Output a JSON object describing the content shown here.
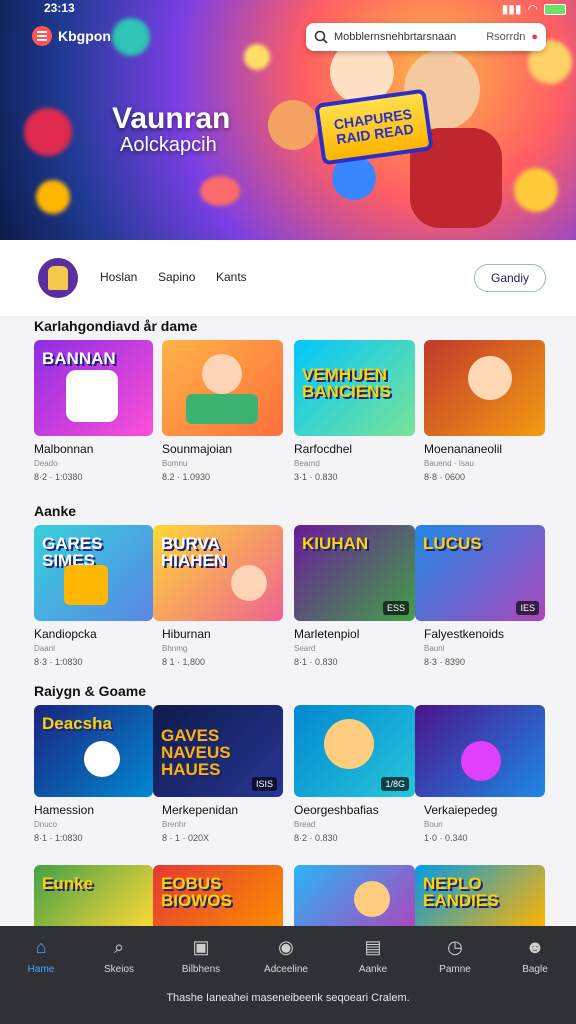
{
  "status": {
    "time": "23:13"
  },
  "header": {
    "app_name": "Kbgpon",
    "search_placeholder": "Mobblernsnehbrtarsnaan",
    "search_button": "Rsorrdn"
  },
  "hero": {
    "title": "Vaunran",
    "subtitle": "Aolckapcih",
    "badge": "CHAPURES RAID READ"
  },
  "profile_bar": {
    "tabs": [
      "Hoslan",
      "Sapino",
      "Kants"
    ],
    "action": "Gandiy"
  },
  "sections": [
    {
      "title": "Karlahgondiavd år dame",
      "cards": [
        {
          "name": "Malbonnan",
          "category": "Deado",
          "stats": "8·2 · 1:0380",
          "overlay": "BANNAN"
        },
        {
          "name": "Sounmajoian",
          "category": "Bomnu",
          "stats": "8.2 · 1.0930",
          "overlay": ""
        },
        {
          "name": "Rarfocdhel",
          "category": "Bearnd",
          "stats": "3·1 · 0.830",
          "overlay": "VEMHUEN BANCIENS"
        },
        {
          "name": "Moenananeolil",
          "category": "Bauend · Isau",
          "stats": "8·8 · 0600",
          "overlay": ""
        }
      ]
    },
    {
      "title": "Aanke",
      "cards": [
        {
          "name": "Kandiopcka",
          "category": "Daanl",
          "stats": "8·3 · 1:0830",
          "overlay": "GARES SIMES",
          "tag": ""
        },
        {
          "name": "Hiburnan",
          "category": "Bhnmg",
          "stats": "8 1 · 1,800",
          "overlay": "BURVA HIAHEN",
          "tag": ""
        },
        {
          "name": "Marletenpiol",
          "category": "Seard",
          "stats": "8·1 · 0.830",
          "overlay": "KIUHAN",
          "tag": "ESS"
        },
        {
          "name": "Falyestkenoids",
          "category": "Bauni",
          "stats": "8·3 · 8390",
          "overlay": "LUCUS",
          "tag": "IES"
        }
      ]
    },
    {
      "title": "Raiygn & Goame",
      "cards": [
        {
          "name": "Hamession",
          "category": "Dnuco",
          "stats": "8·1 · 1:0830",
          "overlay": "Deacsha",
          "tag": ""
        },
        {
          "name": "Merkepenidan",
          "category": "Brenhr",
          "stats": "8 · 1 · 020X",
          "overlay": "GAVES NAVEUS HAUES",
          "tag": "ISIS"
        },
        {
          "name": "Oeorgeshbafias",
          "category": "Bread",
          "stats": "8·2 · 0.830",
          "overlay": "",
          "tag": "1/8G"
        },
        {
          "name": "Verkaiepedeg",
          "category": "Boun",
          "stats": "1·0 · 0.340",
          "overlay": "",
          "tag": ""
        }
      ]
    },
    {
      "title": "",
      "cards": [
        {
          "name": "",
          "category": "",
          "stats": "",
          "overlay": "Eunke"
        },
        {
          "name": "",
          "category": "",
          "stats": "",
          "overlay": "EOBUS BIOWOS"
        },
        {
          "name": "",
          "category": "",
          "stats": "",
          "overlay": ""
        },
        {
          "name": "",
          "category": "",
          "stats": "",
          "overlay": "NEPLO EANDIES"
        }
      ]
    }
  ],
  "nav": {
    "items": [
      {
        "label": "Hame",
        "icon": "home-icon",
        "active": true
      },
      {
        "label": "Skeios",
        "icon": "search-icon",
        "active": false
      },
      {
        "label": "Bilbhens",
        "icon": "folder-icon",
        "active": false
      },
      {
        "label": "Adceeline",
        "icon": "gamepad-icon",
        "active": false
      },
      {
        "label": "Aanke",
        "icon": "monitor-icon",
        "active": false
      },
      {
        "label": "Pamne",
        "icon": "clock-icon",
        "active": false
      },
      {
        "label": "Bagle",
        "icon": "user-icon",
        "active": false
      }
    ],
    "footer": "Thashe Ianeahei maseneibeenk seqoeari Cralem."
  },
  "colors": {
    "accent": "#4aa3ff",
    "nav_bg": "#2f3136",
    "page_bg": "#f4f4f6"
  }
}
